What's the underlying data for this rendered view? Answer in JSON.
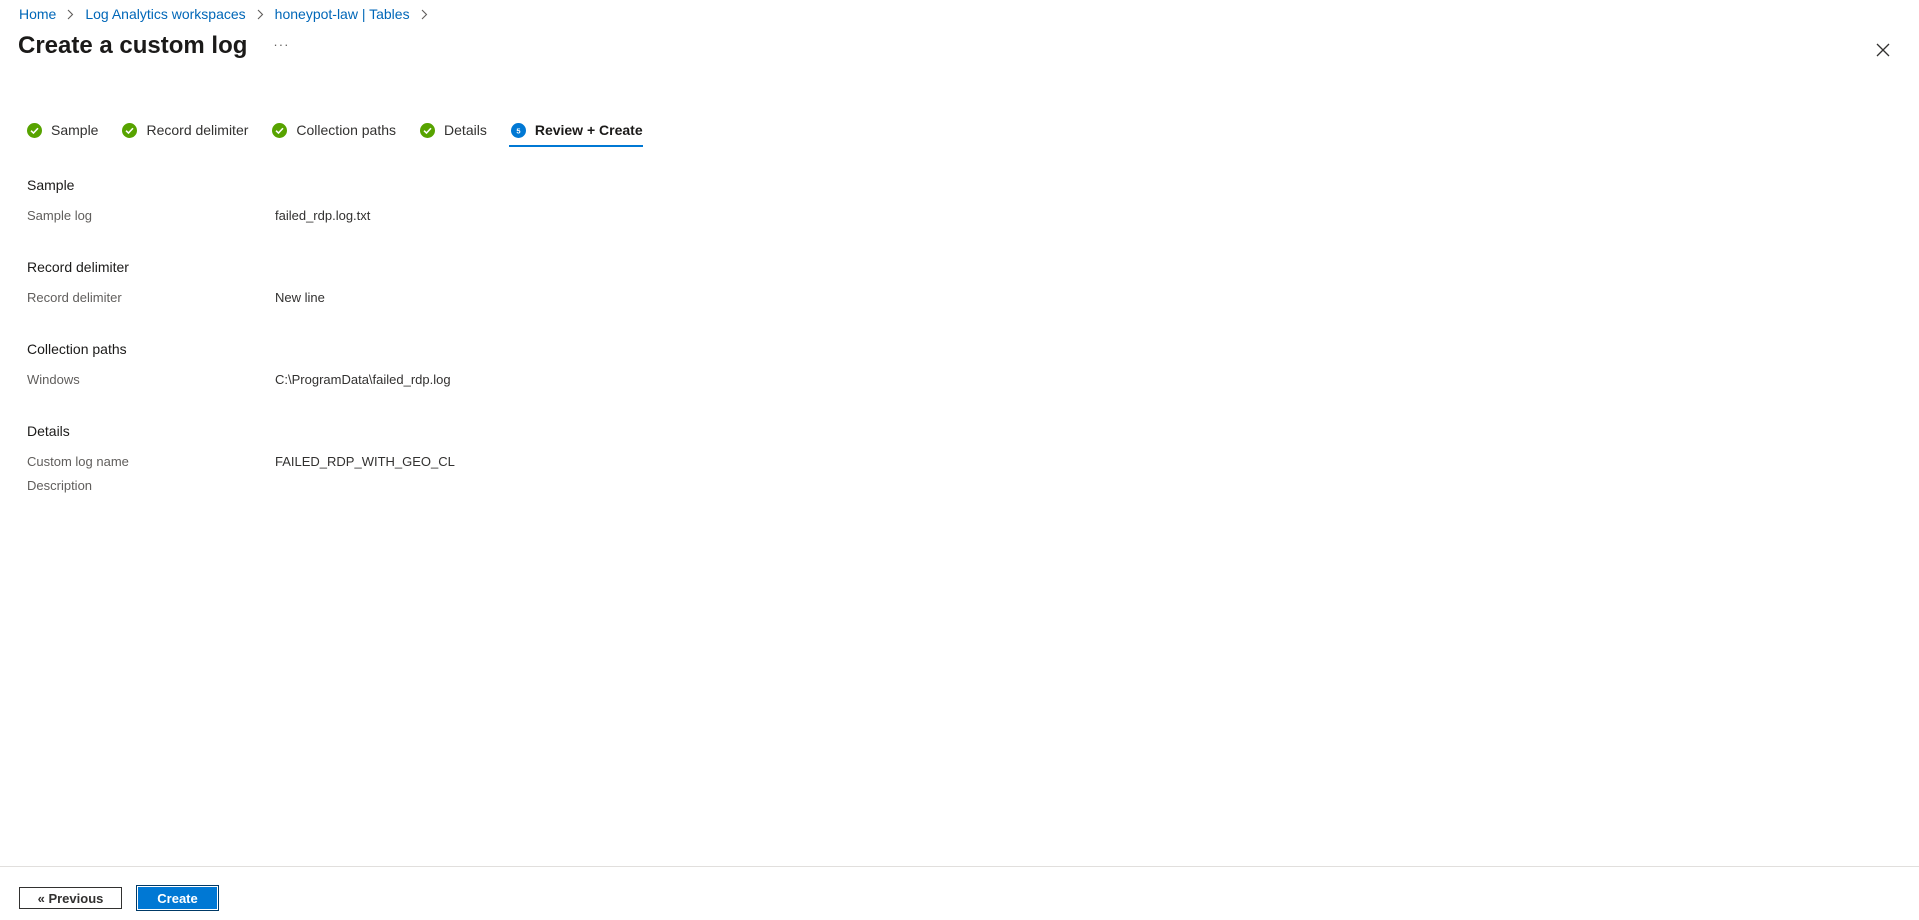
{
  "breadcrumb": [
    {
      "label": "Home"
    },
    {
      "label": "Log Analytics workspaces"
    },
    {
      "label": "honeypot-law | Tables"
    }
  ],
  "page": {
    "title": "Create a custom log",
    "more_label": "···"
  },
  "tabs": [
    {
      "label": "Sample",
      "status": "complete"
    },
    {
      "label": "Record delimiter",
      "status": "complete"
    },
    {
      "label": "Collection paths",
      "status": "complete"
    },
    {
      "label": "Details",
      "status": "complete"
    },
    {
      "label": "Review + Create",
      "status": "active",
      "step": "5"
    }
  ],
  "summary": {
    "sample": {
      "title": "Sample",
      "rows": [
        {
          "label": "Sample log",
          "value": "failed_rdp.log.txt"
        }
      ]
    },
    "record_delimiter": {
      "title": "Record delimiter",
      "rows": [
        {
          "label": "Record delimiter",
          "value": "New line"
        }
      ]
    },
    "collection_paths": {
      "title": "Collection paths",
      "rows": [
        {
          "label": "Windows",
          "value": "C:\\ProgramData\\failed_rdp.log"
        }
      ]
    },
    "details": {
      "title": "Details",
      "rows": [
        {
          "label": "Custom log name",
          "value": "FAILED_RDP_WITH_GEO_CL"
        },
        {
          "label": "Description",
          "value": ""
        }
      ]
    }
  },
  "footer": {
    "previous_label": "« Previous",
    "create_label": "Create"
  },
  "colors": {
    "link": "#0067b8",
    "accent": "#0078d4",
    "success": "#57a300",
    "border": "#e1dfdd"
  },
  "icons": {
    "close": "close-icon",
    "complete": "check-circle-icon",
    "step": "step-number-icon",
    "separator": "chevron-right-icon"
  }
}
